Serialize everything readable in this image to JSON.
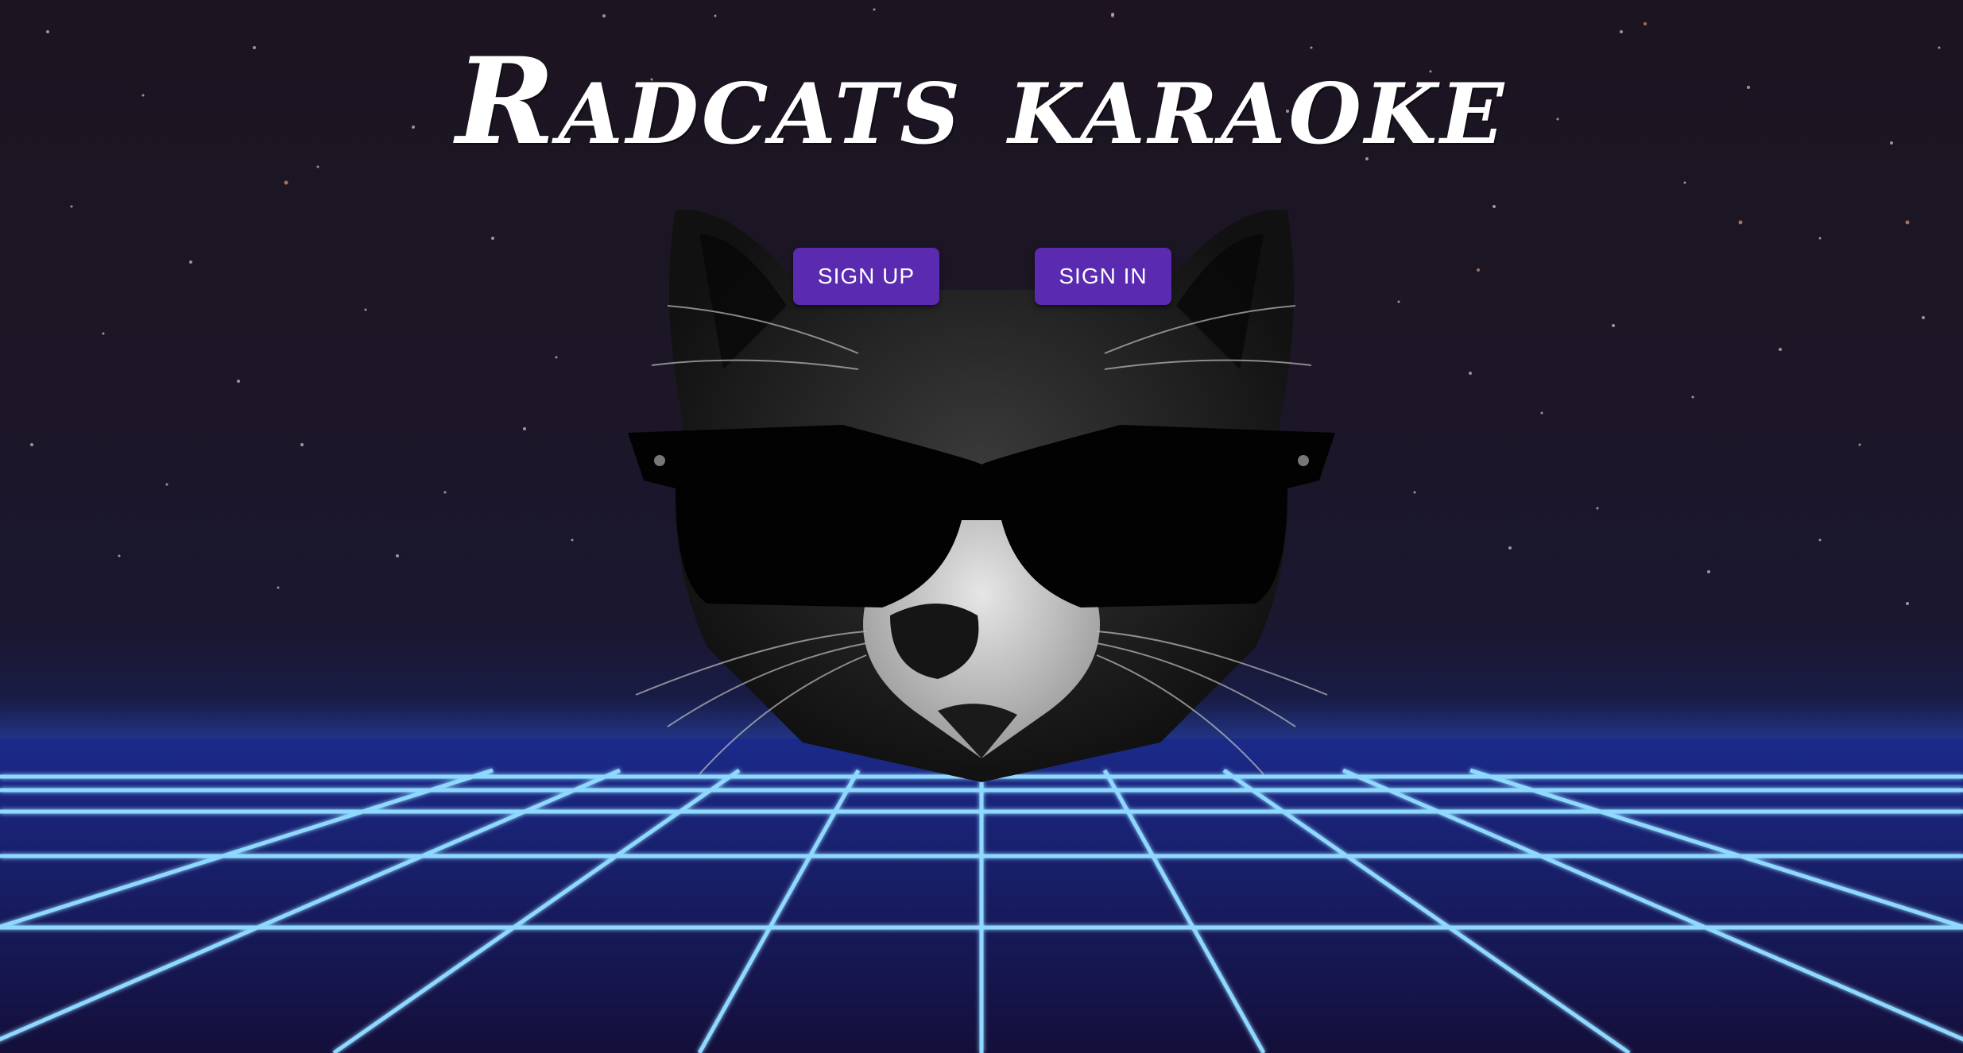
{
  "page": {
    "title": "Radcats karaoke"
  },
  "actions": {
    "sign_up_label": "SIGN UP",
    "sign_in_label": "SIGN IN"
  },
  "colors": {
    "button_bg": "#5a2bb0",
    "grid_line": "#7fd0ff",
    "sky": "#1c1420"
  },
  "icons": {
    "mascot": "cat-with-sunglasses-icon"
  }
}
